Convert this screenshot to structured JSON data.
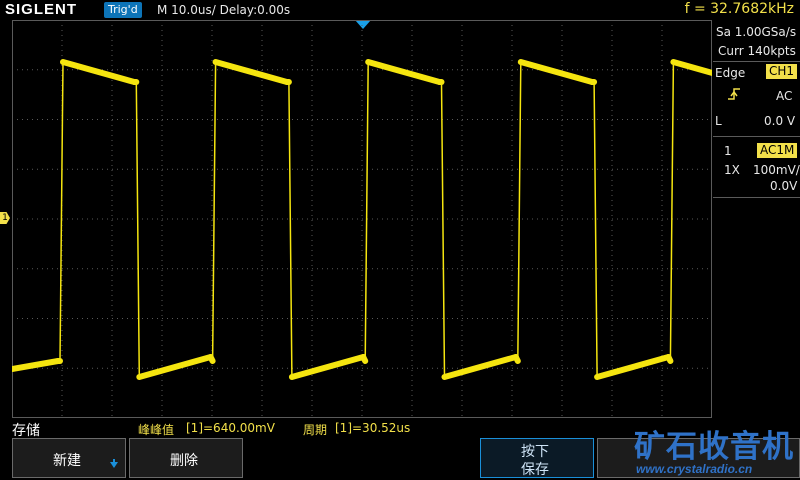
{
  "header": {
    "logo": "SIGLENT",
    "trigger_status": "Trig'd",
    "timebase": "M 10.0us/  Delay:0.00s",
    "frequency": "f = 32.7682kHz"
  },
  "right_panel": {
    "sample_rate": "Sa 1.00GSa/s",
    "memory_depth": "Curr 140kpts",
    "trigger_type": "Edge",
    "trigger_source": "CH1",
    "coupling": "AC",
    "level_label": "L",
    "level_value": "0.0 V",
    "channel_number": "1",
    "channel_coupling": "AC1M",
    "probe": "1X",
    "volts_per_div": "100mV/",
    "offset": "0.0V"
  },
  "channel_marker": "1",
  "bottom": {
    "menu_title": "存储",
    "measure_pkpk_label": "峰峰值",
    "measure_pkpk_value": "[1]=640.00mV",
    "measure_period_label": "周期",
    "measure_period_value": "[1]=30.52us",
    "softkeys": {
      "new": "新建",
      "delete": "删除",
      "press_line1": "按下",
      "press_line2": "保存"
    }
  },
  "watermark": {
    "brand": "矿石收音机",
    "url": "www.crystalradio.cn"
  },
  "colors": {
    "trace": "#f5e50f",
    "accent": "#1a8fd8",
    "grid": "#5a5a5a"
  }
}
